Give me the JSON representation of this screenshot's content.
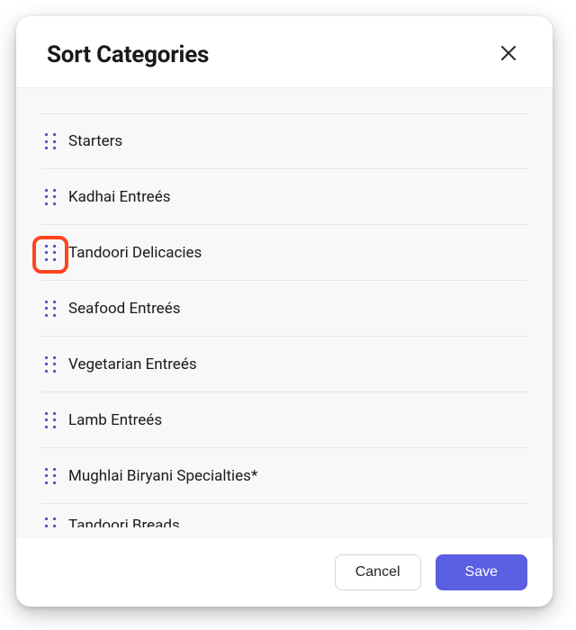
{
  "modal": {
    "title": "Sort Categories",
    "footer": {
      "cancel_label": "Cancel",
      "save_label": "Save"
    }
  },
  "categories": [
    {
      "label": "Starters"
    },
    {
      "label": "Kadhai Entreés"
    },
    {
      "label": "Tandoori Delicacies"
    },
    {
      "label": "Seafood Entreés"
    },
    {
      "label": "Vegetarian Entreés"
    },
    {
      "label": "Lamb Entreés"
    },
    {
      "label": "Mughlai Biryani Specialties*"
    },
    {
      "label": "Tandoori Breads"
    }
  ],
  "highlight_index": 2,
  "colors": {
    "accent": "#5a5ee0",
    "highlight": "#ff4520"
  }
}
